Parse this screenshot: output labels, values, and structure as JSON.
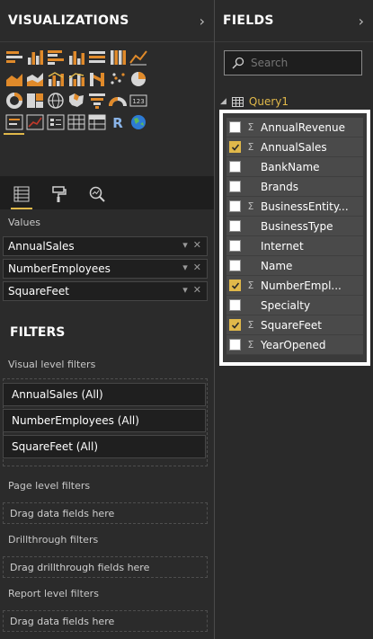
{
  "visualizations": {
    "title": "VISUALIZATIONS",
    "icons": [
      [
        "stacked-bar-chart",
        "stacked-column-chart",
        "clustered-bar-chart",
        "clustered-column-chart",
        "100-percent-stacked-bar-chart",
        "100-percent-stacked-column-chart",
        "line-chart"
      ],
      [
        "area-chart",
        "stacked-area-chart",
        "line-and-stacked-column-chart",
        "line-and-clustered-column-chart",
        "ribbon-chart",
        "scatter-chart",
        "pie-chart"
      ],
      [
        "donut-chart",
        "treemap",
        "map",
        "filled-map",
        "funnel",
        "gauge",
        "card"
      ],
      [
        "multi-row-card",
        "kpi",
        "slicer",
        "table",
        "matrix",
        "r-script-visual",
        "globe-map"
      ],
      [
        "custom-visual-selected",
        "more-visuals"
      ]
    ],
    "values_label": "Values",
    "value_wells": [
      "AnnualSales",
      "NumberEmployees",
      "SquareFeet"
    ]
  },
  "filters": {
    "title": "FILTERS",
    "visual_level_label": "Visual level filters",
    "visual_level_cards": [
      "AnnualSales  (All)",
      "NumberEmployees  (All)",
      "SquareFeet  (All)"
    ],
    "page_level_label": "Page level filters",
    "page_level_drop": "Drag data fields here",
    "drillthrough_label": "Drillthrough filters",
    "drillthrough_drop": "Drag drillthrough fields here",
    "report_level_label": "Report level filters",
    "report_level_drop": "Drag data fields here"
  },
  "fields": {
    "title": "FIELDS",
    "search_placeholder": "Search",
    "dataset": "Query1",
    "items": [
      {
        "name": "AnnualRevenue",
        "checked": false,
        "sigma": true
      },
      {
        "name": "AnnualSales",
        "checked": true,
        "sigma": true
      },
      {
        "name": "BankName",
        "checked": false,
        "sigma": false
      },
      {
        "name": "Brands",
        "checked": false,
        "sigma": false
      },
      {
        "name": "BusinessEntity...",
        "checked": false,
        "sigma": true
      },
      {
        "name": "BusinessType",
        "checked": false,
        "sigma": false
      },
      {
        "name": "Internet",
        "checked": false,
        "sigma": false
      },
      {
        "name": "Name",
        "checked": false,
        "sigma": false
      },
      {
        "name": "NumberEmpl...",
        "checked": true,
        "sigma": true
      },
      {
        "name": "Specialty",
        "checked": false,
        "sigma": false
      },
      {
        "name": "SquareFeet",
        "checked": true,
        "sigma": true
      },
      {
        "name": "YearOpened",
        "checked": false,
        "sigma": true
      }
    ]
  },
  "colors": {
    "accent": "#e0b84a",
    "pane_bg": "#2b2b2b",
    "field_list_border": "#ffffff"
  }
}
